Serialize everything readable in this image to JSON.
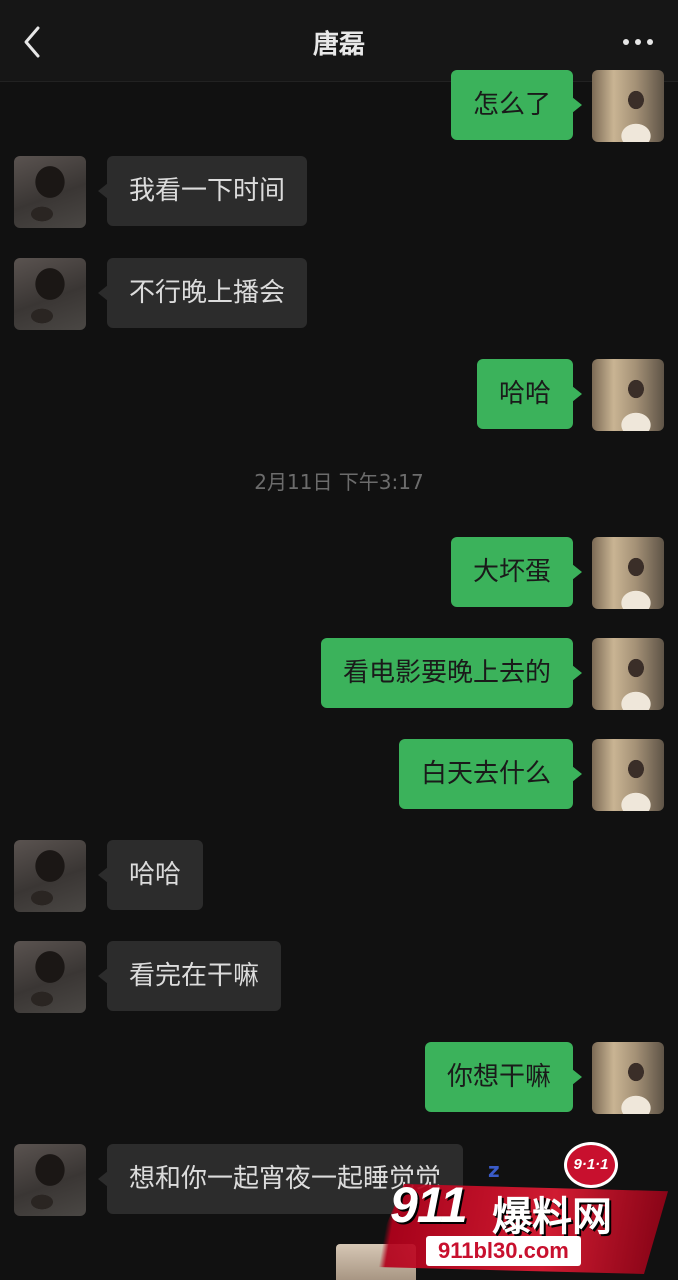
{
  "nav": {
    "title": "唐磊"
  },
  "messages": {
    "m0": "怎么了",
    "m1": "我看一下时间",
    "m2": "不行晚上播会",
    "m3": "哈哈",
    "m4": "大坏蛋",
    "m5": "看电影要晚上去的",
    "m6": "白天去什么",
    "m7": "哈哈",
    "m8": "看完在干嘛",
    "m9": "你想干嘛",
    "m10": "想和你一起宵夜一起睡觉觉"
  },
  "timestamp": "2月11日 下午3:17",
  "watermark": {
    "badge": "9·1·1",
    "number": "911",
    "name": "爆料网",
    "url": "911bl30.com"
  },
  "colors": {
    "sent_bubble": "#3bb25b",
    "received_bubble": "#2c2c2c",
    "background": "#111111"
  },
  "icons": {
    "back": "chevron-left-icon",
    "more": "more-dots-icon"
  }
}
